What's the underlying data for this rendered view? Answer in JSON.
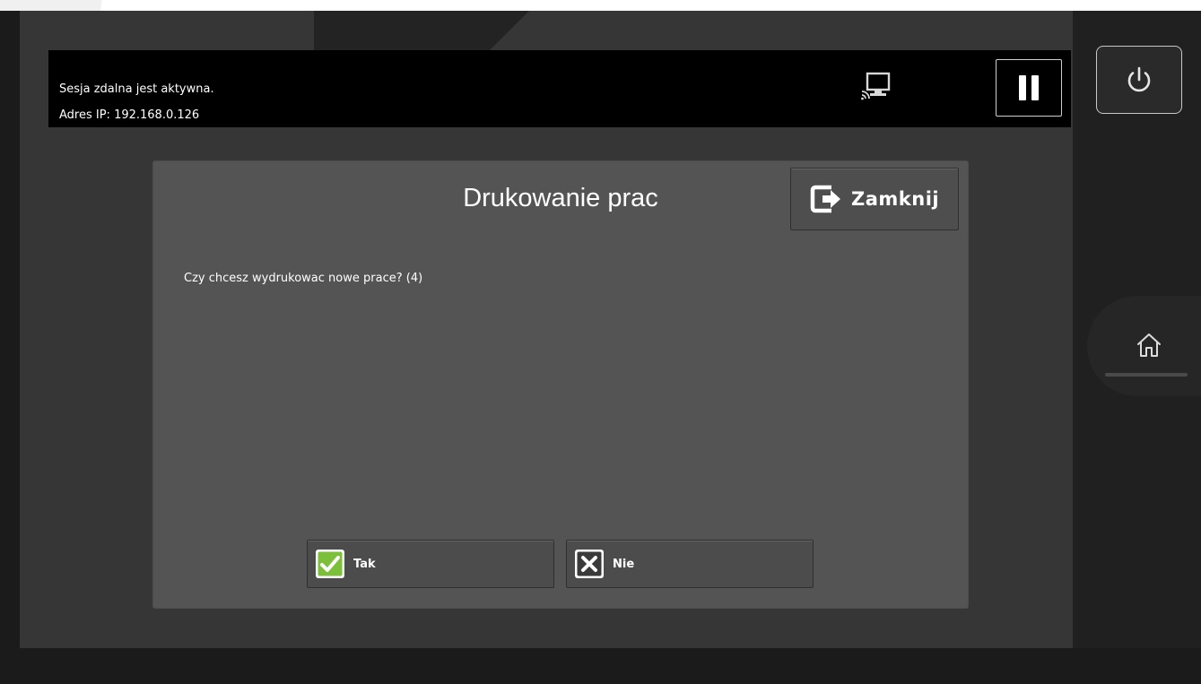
{
  "session": {
    "line1": "Sesja zdalna jest aktywna.",
    "line2": "Adres IP: 192.168.0.126"
  },
  "icons": {
    "remote": "remote-screen-icon",
    "pause": "pause-icon",
    "power": "power-icon",
    "home": "home-icon",
    "close": "exit-icon",
    "yes": "checkmark-icon",
    "no": "x-icon"
  },
  "dialog": {
    "title": "Drukowanie prac",
    "close_label": "Zamknij",
    "question": "Czy chcesz wydrukowac nowe prace? (4)",
    "yes_label": "Tak",
    "no_label": "Nie"
  },
  "colors": {
    "yes_icon": "#7bbf3a",
    "dialog_bg": "#545454",
    "topbar_bg": "#000000"
  }
}
